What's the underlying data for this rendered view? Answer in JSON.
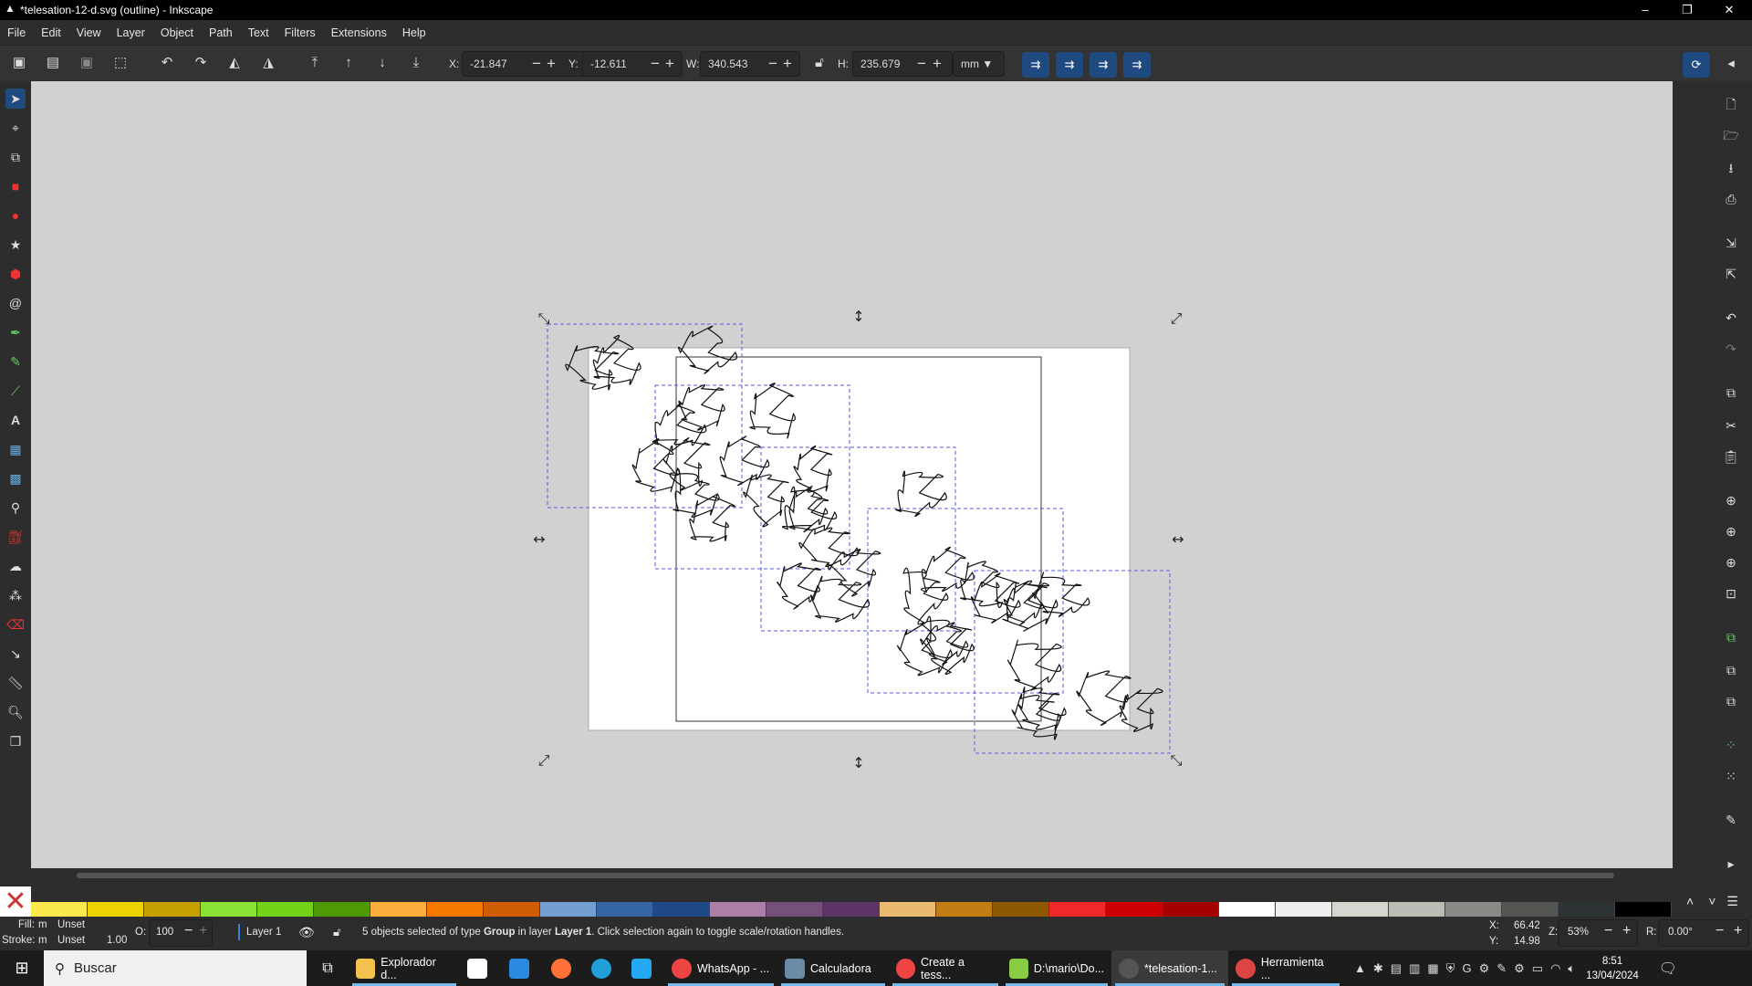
{
  "window": {
    "title": "*telesation-12-d.svg (outline) - Inkscape",
    "minimize": "–",
    "restore": "❐",
    "close": "✕"
  },
  "menu": [
    "File",
    "Edit",
    "View",
    "Layer",
    "Object",
    "Path",
    "Text",
    "Filters",
    "Extensions",
    "Help"
  ],
  "toolbar": {
    "x_label": "X:",
    "x": "-21.847",
    "y_label": "Y:",
    "y": "-12.611",
    "w_label": "W:",
    "w": "340.543",
    "h_label": "H:",
    "h": "235.679",
    "unit": "mm",
    "minus": "−",
    "plus": "+"
  },
  "palette": {
    "none_icon": "✕",
    "colors": [
      "#fce94f",
      "#edd400",
      "#c4a000",
      "#8ae234",
      "#73d216",
      "#4e9a06",
      "#fcaf3e",
      "#f57900",
      "#ce5c00",
      "#729fcf",
      "#3465a4",
      "#204a87",
      "#ad7fa8",
      "#75507b",
      "#5c3566",
      "#e9b96e",
      "#c17d11",
      "#8f5902",
      "#ef2929",
      "#cc0000",
      "#a40000",
      "#ffffff",
      "#eeeeec",
      "#d3d7cf",
      "#babdb6",
      "#888a85",
      "#555753",
      "#2e3436",
      "#000000"
    ]
  },
  "status": {
    "fill_label": "Fill:",
    "fill_m": "m",
    "fill_val": "Unset",
    "stroke_label": "Stroke:",
    "stroke_m": "m",
    "stroke_val": "Unset",
    "stroke_width": "1.00",
    "opacity_label": "O:",
    "opacity": "100",
    "layer": "Layer 1",
    "message_pre": "5 objects selected of type ",
    "message_type": "Group",
    "message_mid": " in layer ",
    "message_layer": "Layer 1",
    "message_post": ". Click selection again to toggle scale/rotation handles.",
    "cx_label": "X:",
    "cx": "66.42",
    "cy_label": "Y:",
    "cy": "14.98",
    "zoom_label": "Z:",
    "zoom": "53%",
    "rot_label": "R:",
    "rotation": "0.00°"
  },
  "taskbar": {
    "search": "Buscar",
    "items": [
      "Explorador d...",
      "WhatsApp - ...",
      "Calculadora",
      "Create a tess...",
      "D:\\mario\\Do...",
      "*telesation-1...",
      "Herramienta ..."
    ],
    "time": "8:51",
    "date": "13/04/2024"
  }
}
